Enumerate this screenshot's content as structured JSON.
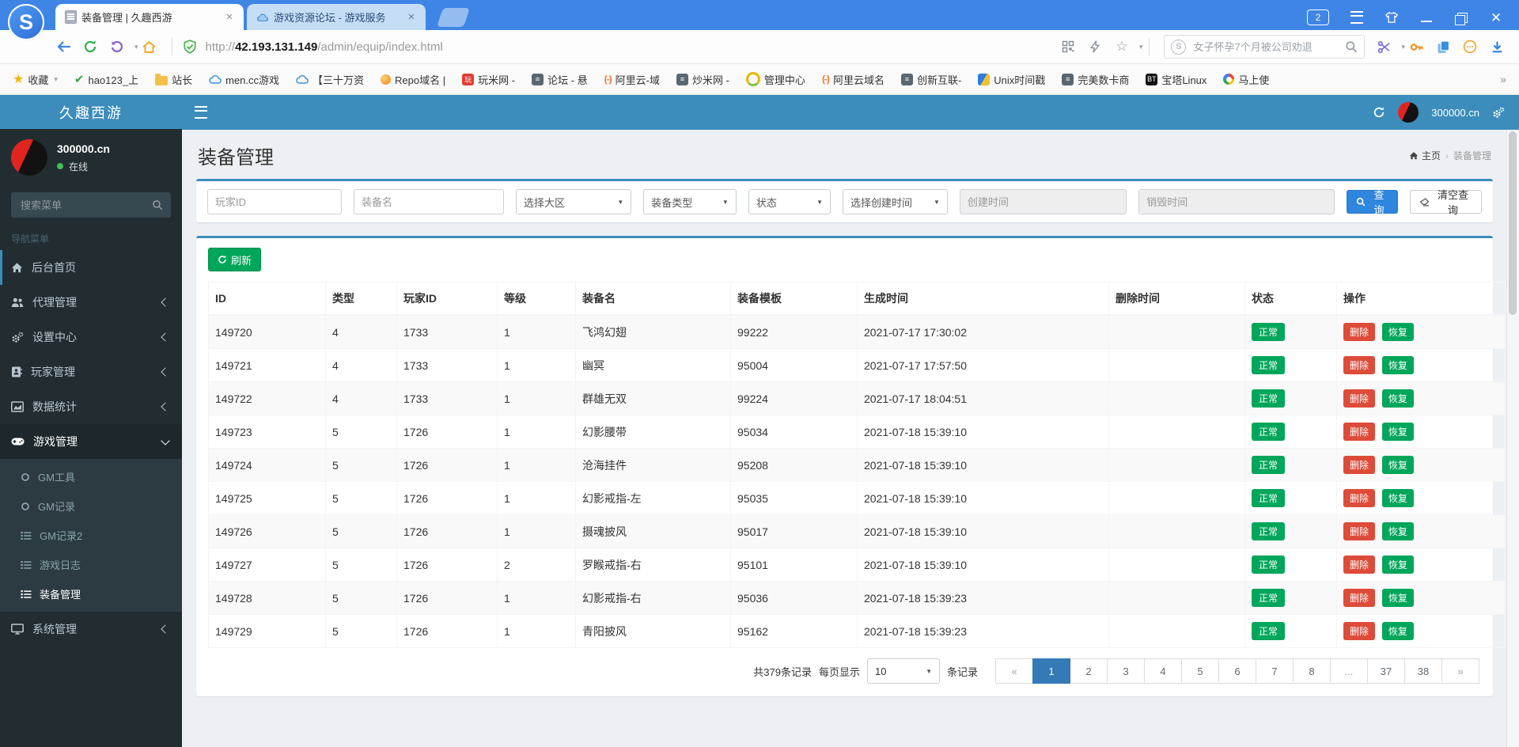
{
  "colors": {
    "browser_chrome": "#3e85e6",
    "admin_navbar": "#3c8dbc",
    "sidebar_bg": "#222d32",
    "sidebar_submenu_bg": "#2c3b41",
    "success_green": "#00a65a",
    "danger_red": "#dd4b39",
    "query_btn_blue": "#2e86de",
    "pagination_active_blue": "#337ab7",
    "page_bg": "#ecf0f5"
  },
  "browser": {
    "logo_letter": "S",
    "tab_count_badge": "2",
    "tabs": [
      {
        "title": "装备管理 | 久趣西游"
      },
      {
        "title": "游戏资源论坛 - 游戏服务"
      }
    ],
    "url": {
      "protocol": "http://",
      "host": "42.193.131.149",
      "path": "/admin/equip/index.html"
    },
    "search": {
      "placeholder": "女子怀孕7个月被公司劝退"
    },
    "bookmarks": [
      {
        "label": "收藏"
      },
      {
        "label": "hao123_上"
      },
      {
        "label": "站长"
      },
      {
        "label": "men.cc游戏"
      },
      {
        "label": "【三十万资"
      },
      {
        "label": "Repo域名 |"
      },
      {
        "label": "玩米网 -",
        "icon_text": "玩"
      },
      {
        "label": "论坛 - 悬"
      },
      {
        "label": "阿里云-域"
      },
      {
        "label": "炒米网 -"
      },
      {
        "label": "管理中心"
      },
      {
        "label": "阿里云域名"
      },
      {
        "label": "创新互联-"
      },
      {
        "label": "Unix时间戳"
      },
      {
        "label": "完美数卡商"
      },
      {
        "label": "宝塔Linux",
        "icon_text": "BT"
      },
      {
        "label": "马上使"
      }
    ]
  },
  "sidebar": {
    "brand": "久趣西游",
    "user": {
      "name": "300000.cn",
      "status": "在线"
    },
    "search_placeholder": "搜索菜单",
    "nav_header": "导航菜单",
    "items": [
      {
        "label": "后台首页"
      },
      {
        "label": "代理管理"
      },
      {
        "label": "设置中心"
      },
      {
        "label": "玩家管理"
      },
      {
        "label": "数据统计"
      },
      {
        "label": "游戏管理"
      },
      {
        "label": "系统管理"
      }
    ],
    "game_submenu": [
      {
        "label": "GM工具"
      },
      {
        "label": "GM记录"
      },
      {
        "label": "GM记录2"
      },
      {
        "label": "游戏日志"
      },
      {
        "label": "装备管理"
      }
    ]
  },
  "topnav": {
    "user": "300000.cn"
  },
  "page": {
    "title": "装备管理",
    "breadcrumb_home": "主页",
    "breadcrumb_current": "装备管理"
  },
  "filters": {
    "player_id_ph": "玩家ID",
    "equip_name_ph": "装备名",
    "zone_select": "选择大区",
    "type_select": "装备类型",
    "status_select": "状态",
    "create_select": "选择创建时间",
    "create_ph": "创建时间",
    "destroy_ph": "销毁时间",
    "query_btn": "查询",
    "clear_btn": "清空查询"
  },
  "table": {
    "refresh_btn": "刷新",
    "headers": [
      "ID",
      "类型",
      "玩家ID",
      "等级",
      "装备名",
      "装备模板",
      "生成时间",
      "删除时间",
      "状态",
      "操作"
    ],
    "status_label": "正常",
    "delete_label": "删除",
    "restore_label": "恢复",
    "rows": [
      {
        "id": "149720",
        "type": "4",
        "player_id": "1733",
        "level": "1",
        "name": "飞鸿幻翅",
        "template": "99222",
        "created": "2021-07-17 17:30:02",
        "deleted": ""
      },
      {
        "id": "149721",
        "type": "4",
        "player_id": "1733",
        "level": "1",
        "name": "幽冥",
        "template": "95004",
        "created": "2021-07-17 17:57:50",
        "deleted": ""
      },
      {
        "id": "149722",
        "type": "4",
        "player_id": "1733",
        "level": "1",
        "name": "群雄无双",
        "template": "99224",
        "created": "2021-07-17 18:04:51",
        "deleted": ""
      },
      {
        "id": "149723",
        "type": "5",
        "player_id": "1726",
        "level": "1",
        "name": "幻影腰带",
        "template": "95034",
        "created": "2021-07-18 15:39:10",
        "deleted": ""
      },
      {
        "id": "149724",
        "type": "5",
        "player_id": "1726",
        "level": "1",
        "name": "沧海挂件",
        "template": "95208",
        "created": "2021-07-18 15:39:10",
        "deleted": ""
      },
      {
        "id": "149725",
        "type": "5",
        "player_id": "1726",
        "level": "1",
        "name": "幻影戒指-左",
        "template": "95035",
        "created": "2021-07-18 15:39:10",
        "deleted": ""
      },
      {
        "id": "149726",
        "type": "5",
        "player_id": "1726",
        "level": "1",
        "name": "摄魂披风",
        "template": "95017",
        "created": "2021-07-18 15:39:10",
        "deleted": ""
      },
      {
        "id": "149727",
        "type": "5",
        "player_id": "1726",
        "level": "2",
        "name": "罗睺戒指-右",
        "template": "95101",
        "created": "2021-07-18 15:39:10",
        "deleted": ""
      },
      {
        "id": "149728",
        "type": "5",
        "player_id": "1726",
        "level": "1",
        "name": "幻影戒指-右",
        "template": "95036",
        "created": "2021-07-18 15:39:23",
        "deleted": ""
      },
      {
        "id": "149729",
        "type": "5",
        "player_id": "1726",
        "level": "1",
        "name": "青阳披风",
        "template": "95162",
        "created": "2021-07-18 15:39:23",
        "deleted": ""
      }
    ]
  },
  "pagination": {
    "total_text": "共379条记录",
    "per_page_label": "每页显示",
    "per_page_value": "10",
    "records_label": "条记录",
    "pages": [
      "«",
      "1",
      "2",
      "3",
      "4",
      "5",
      "6",
      "7",
      "8",
      "...",
      "37",
      "38",
      "»"
    ],
    "active_page": "1"
  }
}
